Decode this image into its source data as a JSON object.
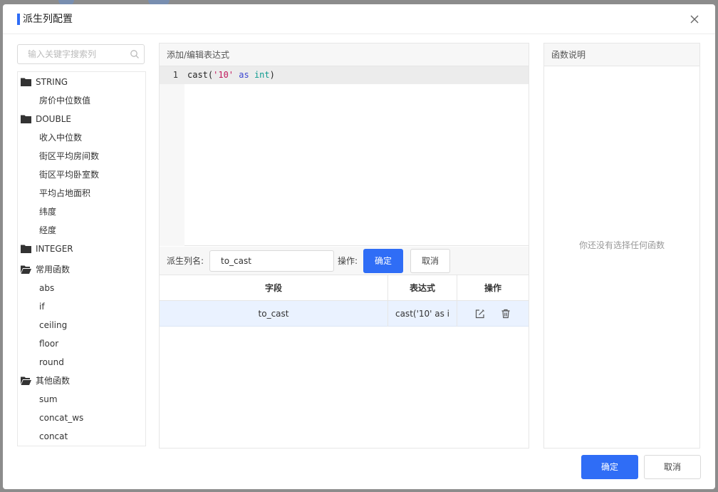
{
  "dialog": {
    "title": "派生列配置"
  },
  "search": {
    "placeholder": "输入关键字搜索列"
  },
  "tree": [
    {
      "type": "folder",
      "label": "STRING"
    },
    {
      "type": "leaf",
      "label": "房价中位数值"
    },
    {
      "type": "folder",
      "label": "DOUBLE"
    },
    {
      "type": "leaf",
      "label": "收入中位数"
    },
    {
      "type": "leaf",
      "label": "街区平均房间数"
    },
    {
      "type": "leaf",
      "label": "街区平均卧室数"
    },
    {
      "type": "leaf",
      "label": "平均占地面积"
    },
    {
      "type": "leaf",
      "label": "纬度"
    },
    {
      "type": "leaf",
      "label": "经度"
    },
    {
      "type": "folder",
      "label": "INTEGER"
    },
    {
      "type": "folder",
      "label": "常用函数"
    },
    {
      "type": "leaf",
      "label": "abs"
    },
    {
      "type": "leaf",
      "label": "if"
    },
    {
      "type": "leaf",
      "label": "ceiling"
    },
    {
      "type": "leaf",
      "label": "floor"
    },
    {
      "type": "leaf",
      "label": "round"
    },
    {
      "type": "folder",
      "label": "其他函数"
    },
    {
      "type": "leaf",
      "label": "sum"
    },
    {
      "type": "leaf",
      "label": "concat_ws"
    },
    {
      "type": "leaf",
      "label": "concat"
    }
  ],
  "editor": {
    "title": "添加/编辑表达式",
    "line_number": "1",
    "tokens": {
      "fn": "cast(",
      "str": "'10'",
      "kw": "as",
      "type": "int",
      "close": ")"
    }
  },
  "form": {
    "name_label": "派生列名:",
    "name_value": "to_cast",
    "action_label": "操作:",
    "confirm_label": "确定",
    "cancel_label": "取消"
  },
  "table": {
    "headers": [
      "字段",
      "表达式",
      "操作"
    ],
    "rows": [
      {
        "field": "to_cast",
        "expression": "cast('10' as i"
      }
    ]
  },
  "help": {
    "title": "函数说明",
    "empty_text": "你还没有选择任何函数"
  },
  "footer": {
    "ok_label": "确定",
    "cancel_label": "取消"
  },
  "colors": {
    "primary": "#2f6df6",
    "selected_row": "#eaf2ff"
  }
}
